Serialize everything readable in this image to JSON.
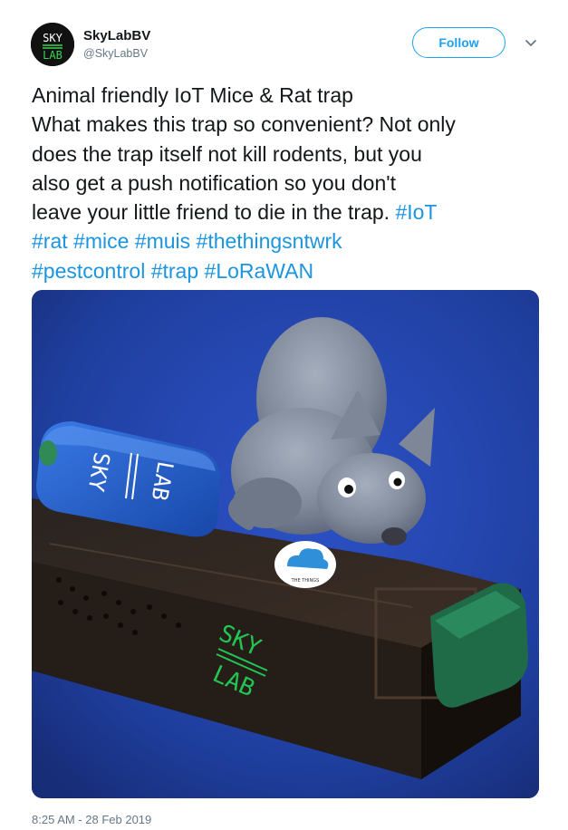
{
  "author": {
    "display_name": "SkyLabBV",
    "handle": "@SkyLabBV",
    "avatar_logo_text": [
      "SKY",
      "LAB"
    ]
  },
  "actions": {
    "follow_label": "Follow",
    "caret_icon": "chevron-down-icon"
  },
  "tweet": {
    "lines": [
      [
        {
          "text": "Animal friendly IoT Mice & Rat trap",
          "hashtag": false
        }
      ],
      [
        {
          "text": "What makes this trap so convenient? Not only",
          "hashtag": false
        }
      ],
      [
        {
          "text": "does the trap itself not kill rodents, but you",
          "hashtag": false
        }
      ],
      [
        {
          "text": "also get a push notification so you don't",
          "hashtag": false
        }
      ],
      [
        {
          "text": "leave your little friend to die in the trap. ",
          "hashtag": false
        },
        {
          "text": "#IoT",
          "hashtag": true
        }
      ],
      [
        {
          "text": "#rat",
          "hashtag": true
        },
        {
          "text": " ",
          "hashtag": false
        },
        {
          "text": "#mice",
          "hashtag": true
        },
        {
          "text": " ",
          "hashtag": false
        },
        {
          "text": "#muis",
          "hashtag": true
        },
        {
          "text": " ",
          "hashtag": false
        },
        {
          "text": "#thethingsntwrk",
          "hashtag": true
        }
      ],
      [
        {
          "text": "#pestcontrol",
          "hashtag": true
        },
        {
          "text": " ",
          "hashtag": false
        },
        {
          "text": "#trap",
          "hashtag": true
        },
        {
          "text": " ",
          "hashtag": false
        },
        {
          "text": "#LoRaWAN",
          "hashtag": true
        }
      ]
    ]
  },
  "media": {
    "device_logo_text": [
      "SKY",
      "LAB"
    ],
    "sticker_text": "THE THINGS"
  },
  "timestamp": "8:25 AM - 28 Feb 2019",
  "colors": {
    "link": "#1b95e0",
    "follow": "#1da1f2",
    "secondary_text": "#657786",
    "primary_text": "#14171a"
  }
}
